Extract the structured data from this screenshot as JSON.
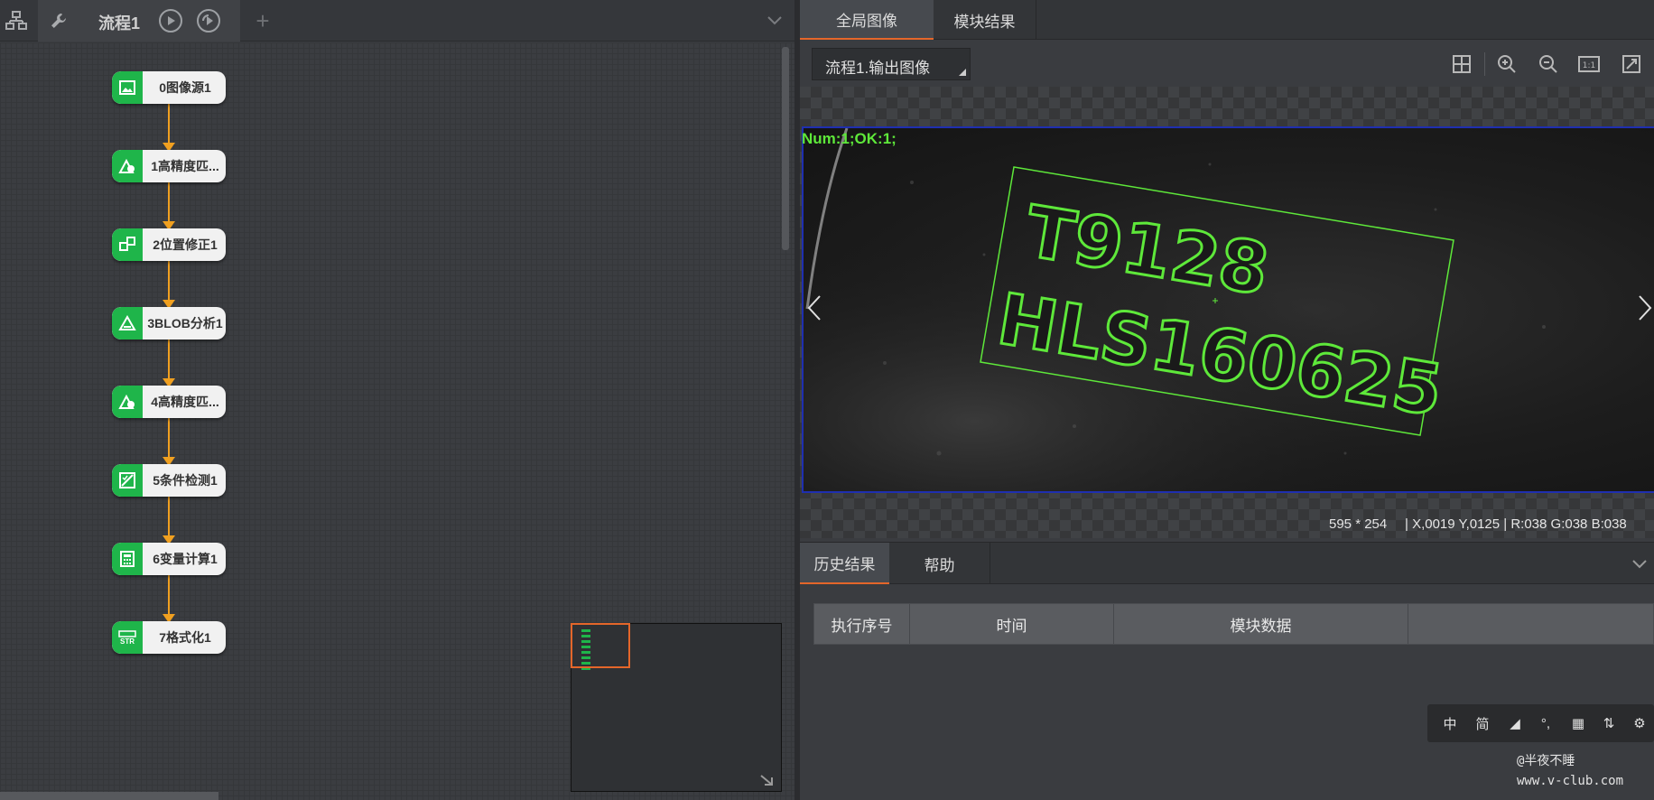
{
  "left_toolbar": {
    "process_title": "流程1",
    "icons": [
      "flowchart-icon",
      "wrench-icon",
      "run-once-icon",
      "run-loop-icon",
      "add-process-icon",
      "chevron-down-icon"
    ]
  },
  "flow": {
    "nodes": [
      {
        "label": "0图像源1",
        "icon": "image-source-icon"
      },
      {
        "label": "1高精度匹...",
        "icon": "pattern-match-icon"
      },
      {
        "label": "2位置修正1",
        "icon": "position-fix-icon"
      },
      {
        "label": "3BLOB分析1",
        "icon": "blob-icon"
      },
      {
        "label": "4高精度匹...",
        "icon": "pattern-match-icon"
      },
      {
        "label": "5条件检测1",
        "icon": "condition-check-icon"
      },
      {
        "label": "6变量计算1",
        "icon": "calculator-icon"
      },
      {
        "label": "7格式化1",
        "icon": "format-str-icon"
      }
    ],
    "node_icon_color": "#1fb54a",
    "connector_color": "#f0a020",
    "str_badge": "STR"
  },
  "right_tabs": {
    "global_image": "全局图像",
    "module_result": "模块结果"
  },
  "image_view": {
    "source_select": "流程1.输出图像",
    "overlay_text": "Num:1;OK:1;",
    "ocr_line1": "T9128",
    "ocr_line2": "HLS160625",
    "size_text": "595 * 254",
    "coords_text": "| X,0019  Y,0125  |  R:038  G:038  B:038",
    "overlay_color": "#5ee83a"
  },
  "bottom_tabs": {
    "history": "历史结果",
    "help": "帮助"
  },
  "history_table": {
    "columns": [
      "执行序号",
      "时间",
      "模块数据",
      ""
    ]
  },
  "ime_bar": {
    "items": [
      "中",
      "简",
      "◢",
      "°,",
      "▦",
      "⇅",
      "⚙"
    ]
  },
  "watermark": {
    "line1": "@半夜不睡",
    "line2": "www.v-club.com"
  },
  "accent_color": "#e4662a"
}
